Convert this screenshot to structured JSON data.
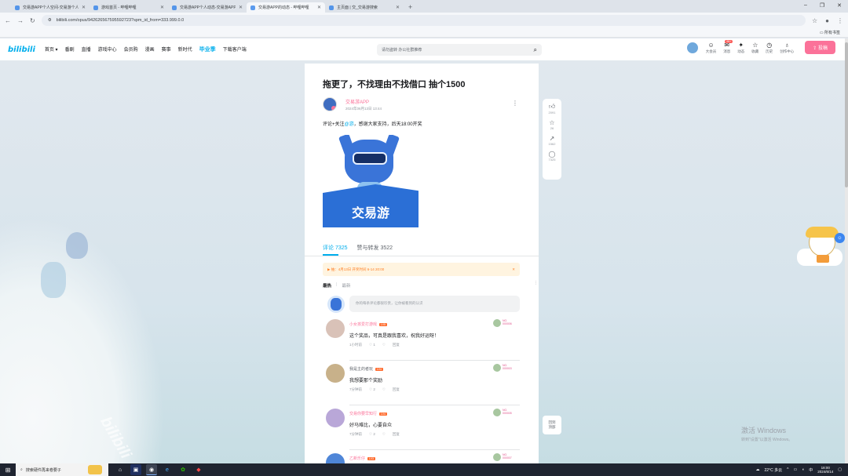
{
  "browser": {
    "tabs": [
      {
        "title": "交易游APP个人空间-交易游个人...",
        "active": false
      },
      {
        "title": "游戏首页 - 哔哩哔哩",
        "active": false
      },
      {
        "title": "交易游APP个人动态-交易游APP...",
        "active": false
      },
      {
        "title": "交易游APP的动态 - 哔哩哔哩",
        "active": true
      },
      {
        "title": "主页面 | 交_交易游搜索",
        "active": false
      }
    ],
    "url": "bilibili.com/opus/942626567595592723?spm_id_from=333.999.0.0",
    "bookmarks_label": "所有书签",
    "window_buttons": [
      "‒",
      "❐",
      "✕"
    ]
  },
  "site_header": {
    "logo": "bilibili",
    "menu": [
      "首页 ▾",
      "番剧",
      "直播",
      "游戏中心",
      "会员购",
      "漫画",
      "赛事",
      "新时代",
      "毕业季",
      "下载客户端"
    ],
    "search_placeholder": "请勿盗转 办公社群推荐",
    "right_items": [
      {
        "label": "大会员",
        "icon": "☺"
      },
      {
        "label": "消息",
        "icon": "✉",
        "badge": "99+"
      },
      {
        "label": "动态",
        "icon": "✦"
      },
      {
        "label": "收藏",
        "icon": "☆"
      },
      {
        "label": "历史",
        "icon": "◷"
      },
      {
        "label": "创作中心",
        "icon": "♁"
      }
    ],
    "upload_label": "投稿"
  },
  "post": {
    "title": "拖更了，不找理由不找借口 抽个1500",
    "author": "交易游APP",
    "date": "2024年06月13日 13:44",
    "body_prefix": "评论+关注",
    "body_link": "@游",
    "body_suffix": "，感谢大家支持，后天18:00开奖",
    "image_text": "交易游"
  },
  "comments_section": {
    "tab_comments": "评论 7325",
    "tab_forwards": "赞与转发 3522",
    "notice": "▶  抽：4月13日 开奖时间 6-14 20:00",
    "sort_hot": "最热",
    "sort_sep": "|",
    "sort_new": "最新",
    "input_placeholder": "你的每条评论都很珍贵，让你被看到的认识",
    "items": [
      {
        "name": "小女孩爱打游戏",
        "level": "LV5",
        "text": "这个奖品，可真是跟我喜欢，祝我好运呀！",
        "date": "1小时前",
        "likes": "1",
        "reply": "回复",
        "fan": "NO.\n000006"
      },
      {
        "name": "我是主的者玩",
        "level": "LV4",
        "text": "我想要那个奖励",
        "date": "7分钟前",
        "likes": "2",
        "reply": "回复",
        "fan": "NO.\n000003"
      },
      {
        "name": "交易你要早知行",
        "level": "LV4",
        "text": "好马难比，心要自众",
        "date": "7分钟前",
        "likes": "2",
        "reply": "回复",
        "fan": "NO.\n000005"
      },
      {
        "name": "乙新乐仔",
        "level": "LV3",
        "text": "",
        "date": "",
        "likes": "",
        "reply": "",
        "fan": "NO.\n000007"
      }
    ]
  },
  "side_actions": [
    {
      "icon": "👍",
      "count": "2091"
    },
    {
      "icon": "☆",
      "count": "26"
    },
    {
      "icon": "↗",
      "count": "1562"
    },
    {
      "icon": "💬",
      "count": "7325"
    }
  ],
  "side_bottom": "回到\n顶部",
  "watermark_text": "bilibili",
  "windows_activation": {
    "line1": "激活 Windows",
    "line2": "转到\"设置\"以激活 Windows。"
  },
  "taskbar": {
    "search_placeholder": "搜索硬件再来卷要子",
    "weather": "22°C 多云",
    "time": "18:00",
    "date": "2024/6/14",
    "apps": [
      "⌂",
      "▣",
      "◉",
      "e",
      "✿",
      "◆"
    ]
  }
}
